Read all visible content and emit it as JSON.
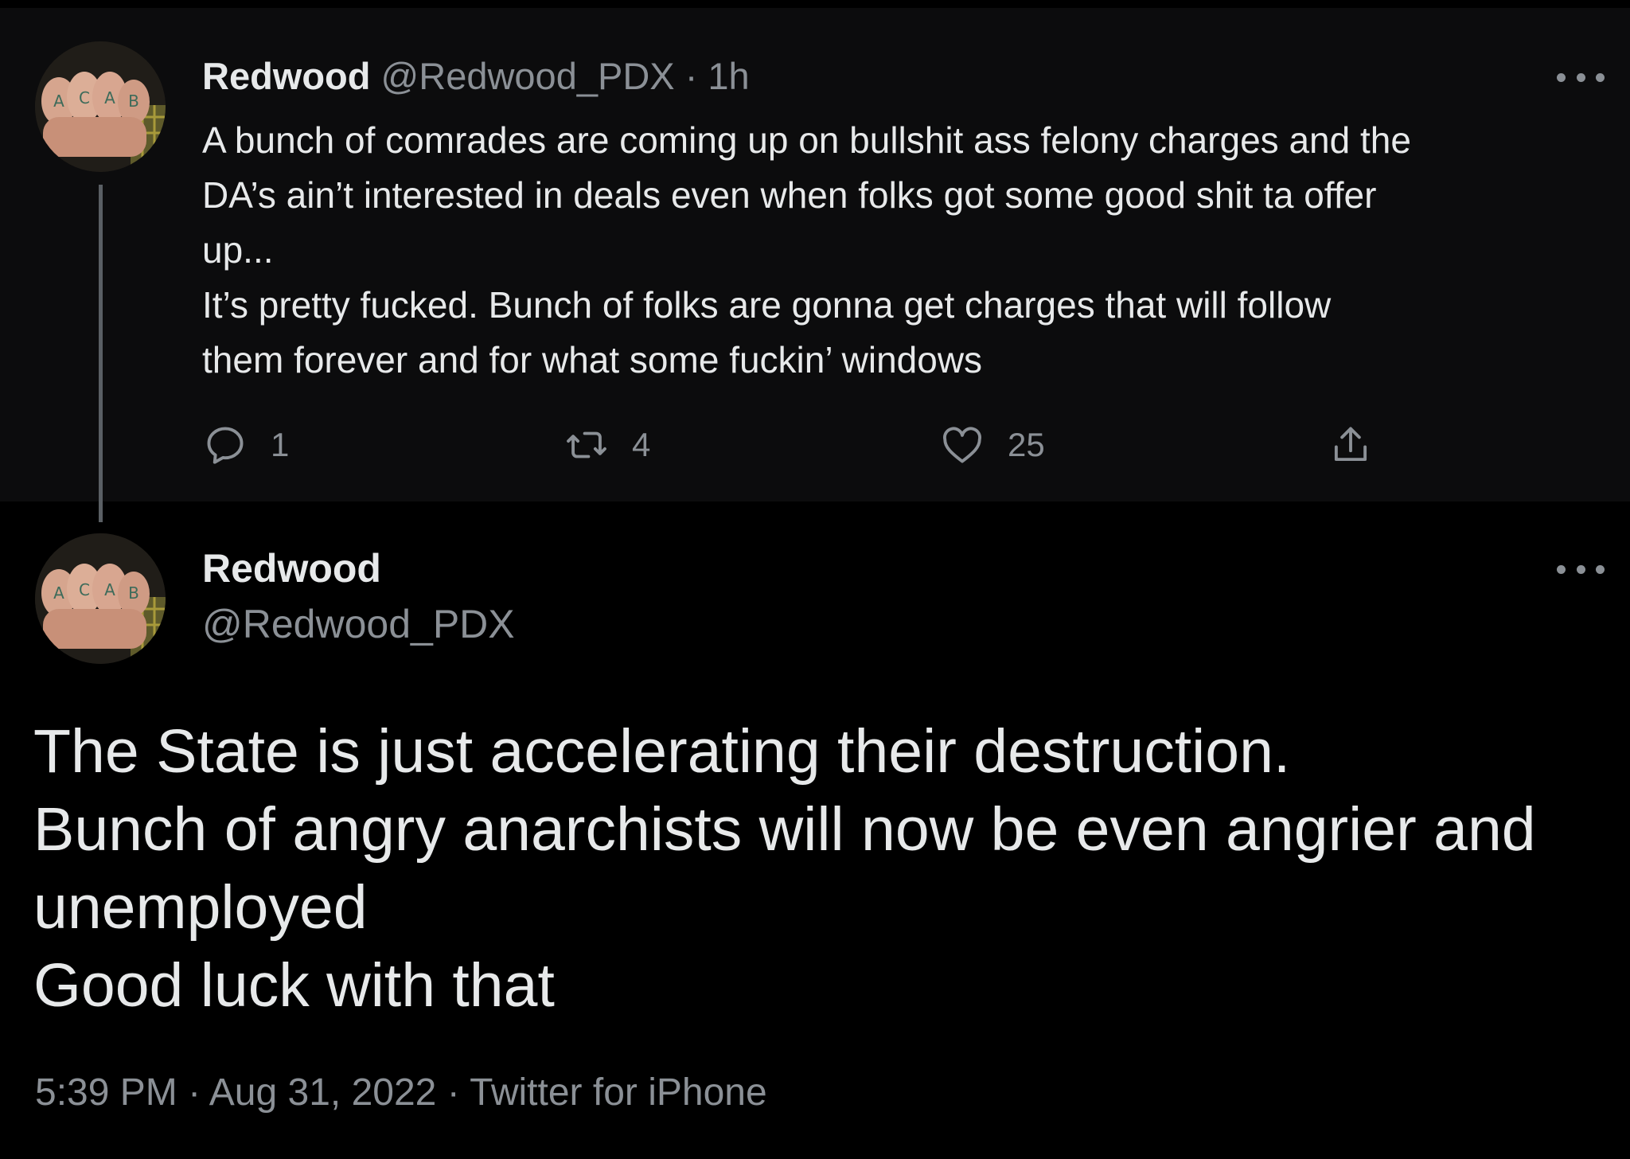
{
  "parent_tweet": {
    "display_name": "Redwood",
    "handle": "@Redwood_PDX",
    "separator": "·",
    "time_ago": "1h",
    "text_lines": [
      "A bunch of comrades are coming up on bullshit ass felony charges and the",
      "DA’s ain’t interested in deals even when folks got some good shit ta offer",
      "up...",
      "It’s pretty fucked. Bunch of folks are gonna get charges that will follow",
      "them forever and for what some fuckin’ windows"
    ],
    "counts": {
      "replies": "1",
      "retweets": "4",
      "likes": "25"
    },
    "icons": [
      "reply-icon",
      "retweet-icon",
      "like-icon",
      "share-icon",
      "more-icon"
    ]
  },
  "reply_tweet": {
    "display_name": "Redwood",
    "handle": "@Redwood_PDX",
    "text_lines": [
      "The State is just accelerating their destruction.",
      "Bunch of angry anarchists will now be even angrier and",
      "unemployed",
      "Good luck with that"
    ],
    "timestamp": "5:39 PM",
    "date": "Aug 31, 2022",
    "source": "Twitter for iPhone",
    "separator": "·"
  },
  "avatar_lettering": [
    "A",
    "C",
    "A",
    "B"
  ],
  "colors": {
    "background": "#000000",
    "parent_background": "#0c0c0d",
    "text": "#e7e9ea",
    "secondary": "#8b9096"
  }
}
